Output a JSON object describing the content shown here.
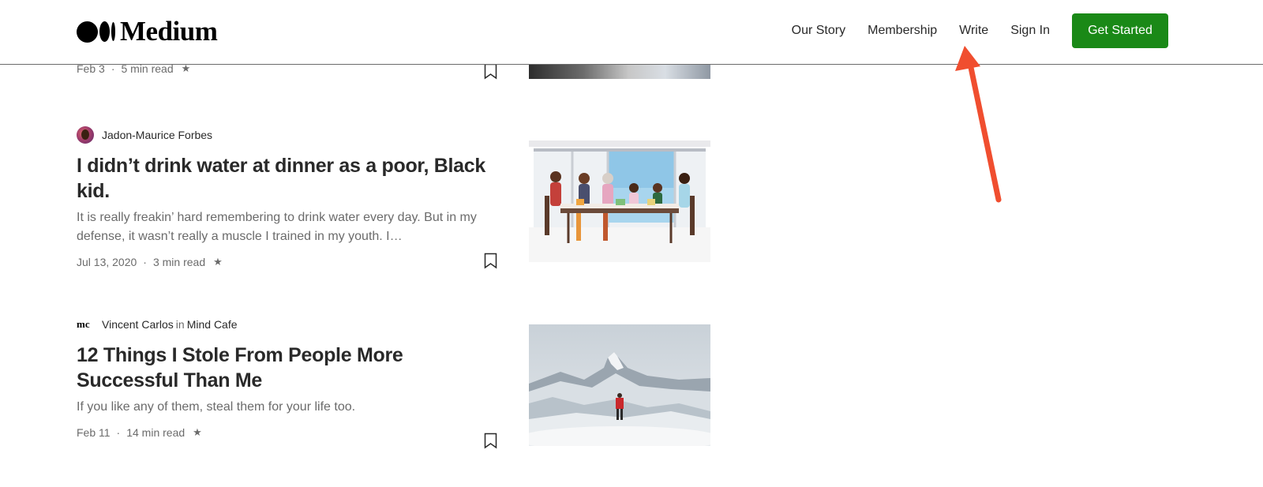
{
  "header": {
    "logo_text": "Medium",
    "nav": {
      "our_story": "Our Story",
      "membership": "Membership",
      "write": "Write",
      "sign_in": "Sign In",
      "get_started": "Get Started"
    },
    "get_started_color": "#1a8917"
  },
  "articles": [
    {
      "date": "Feb 3",
      "read_time": "5 min read",
      "star": "★"
    },
    {
      "author": "Jadon-Maurice Forbes",
      "title": "I didn’t drink water at dinner as a poor, Black kid.",
      "subtitle": "It is really freakin’ hard remembering to drink water every day. But in my defense, it wasn’t really a muscle I trained in my youth. I…",
      "date": "Jul 13, 2020",
      "read_time": "3 min read",
      "star": "★"
    },
    {
      "author": "Vincent Carlos",
      "in": "in",
      "publication": "Mind Cafe",
      "pub_logo": "mc",
      "title": "12 Things I Stole From People More Successful Than Me",
      "subtitle": "If you like any of them, steal them for your life too.",
      "date": "Feb 11",
      "read_time": "14 min read",
      "star": "★"
    }
  ],
  "annotation_color": "#f04e2f"
}
